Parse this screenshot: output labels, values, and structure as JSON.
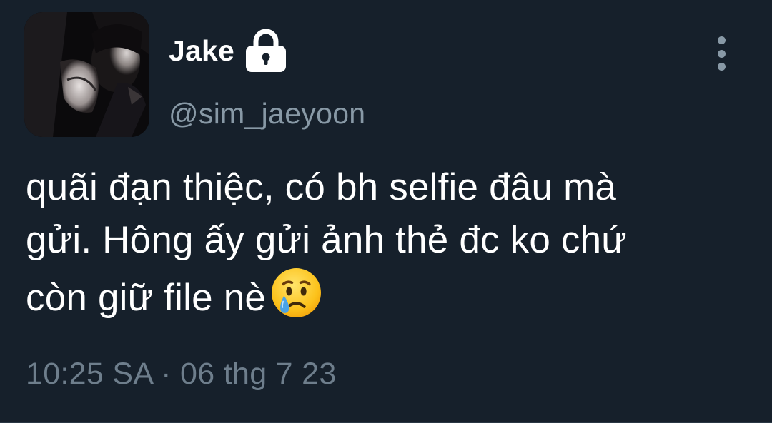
{
  "tweet": {
    "author": {
      "display_name": "Jake",
      "handle": "@sim_jaeyoon",
      "protected_icon": "lock-icon",
      "avatar": "profile-photo"
    },
    "menu_icon": "more-vertical-icon",
    "text_lines": [
      "quãi đạn thiệc, có bh selfie đâu mà",
      "gửi. Hông ấy gửi ảnh thẻ đc ko chứ",
      "còn giữ file nè"
    ],
    "emoji": "crying-face-emoji",
    "timestamp": "10:25 SA · 06 thg 7 23"
  },
  "colors": {
    "background": "#16202b",
    "primary_text": "#ffffff",
    "secondary_text": "#8899a6",
    "timestamp_text": "#6e7e8c"
  }
}
